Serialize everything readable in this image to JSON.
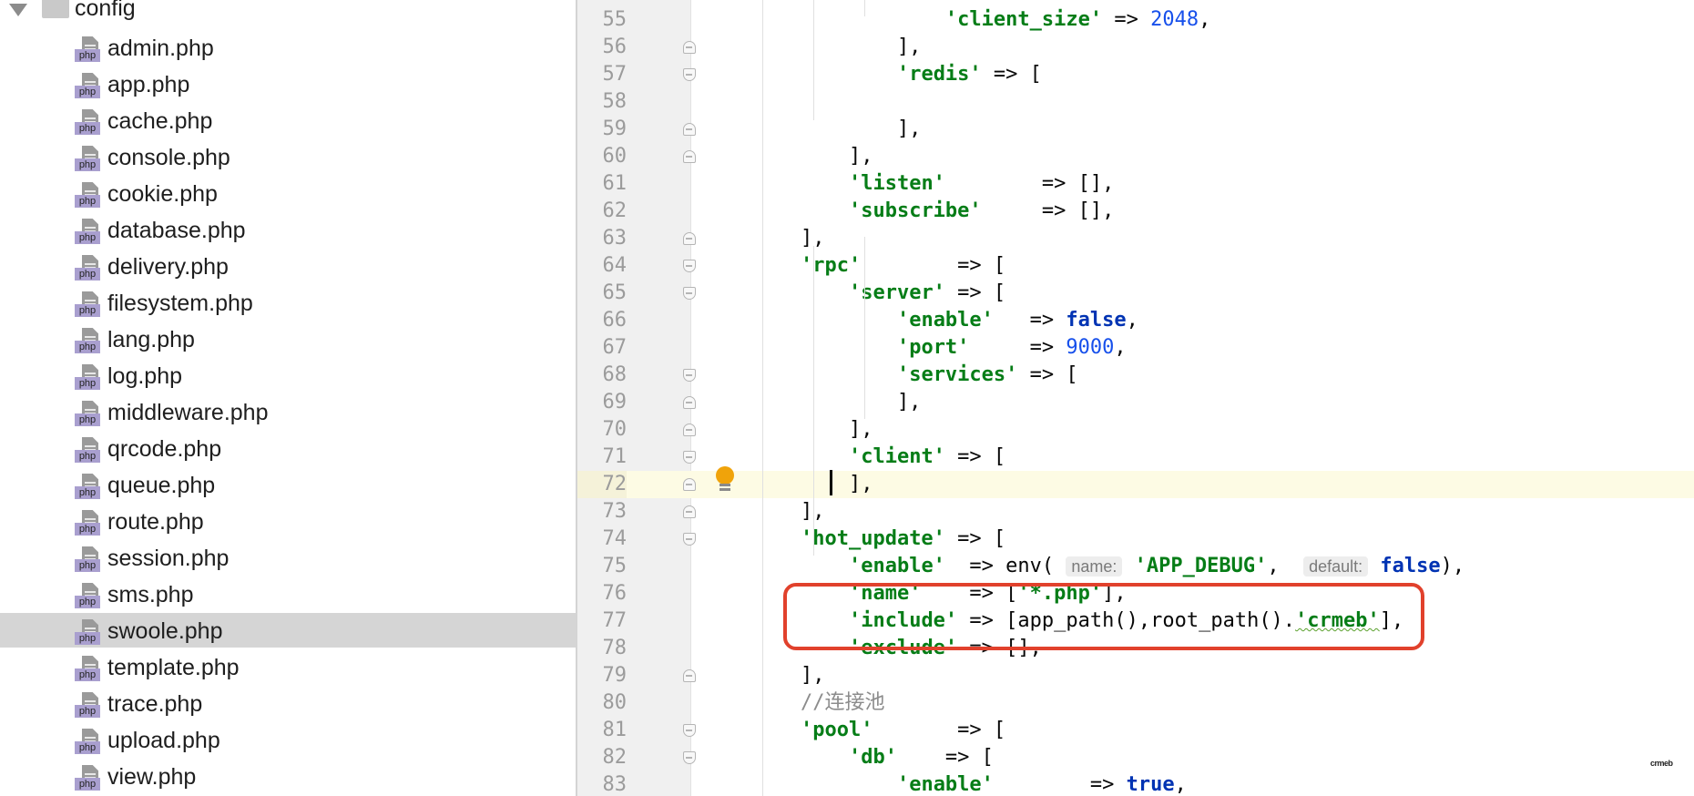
{
  "tree": {
    "folder": "config",
    "files": [
      "admin.php",
      "app.php",
      "cache.php",
      "console.php",
      "cookie.php",
      "database.php",
      "delivery.php",
      "filesystem.php",
      "lang.php",
      "log.php",
      "middleware.php",
      "qrcode.php",
      "queue.php",
      "route.php",
      "session.php",
      "sms.php",
      "swoole.php",
      "template.php",
      "trace.php",
      "upload.php",
      "view.php"
    ],
    "selected": "swoole.php",
    "file_tag": "php"
  },
  "editor": {
    "current_line": "72",
    "lines": [
      {
        "n": "55",
        "fold": "",
        "code": "                <s>'client_size'</s> => <n>2048</n>,"
      },
      {
        "n": "56",
        "fold": "close",
        "code": "            ],"
      },
      {
        "n": "57",
        "fold": "open",
        "code": "            <s>'redis'</s> => ["
      },
      {
        "n": "58",
        "fold": "",
        "code": ""
      },
      {
        "n": "59",
        "fold": "close",
        "code": "            ],"
      },
      {
        "n": "60",
        "fold": "close",
        "code": "        ],"
      },
      {
        "n": "61",
        "fold": "",
        "code": "        <s>'listen'</s>        => [],"
      },
      {
        "n": "62",
        "fold": "",
        "code": "        <s>'subscribe'</s>     => [],"
      },
      {
        "n": "63",
        "fold": "close",
        "code": "    ],"
      },
      {
        "n": "64",
        "fold": "open",
        "code": "    <s>'rpc'</s>        => ["
      },
      {
        "n": "65",
        "fold": "open",
        "code": "        <s>'server'</s> => ["
      },
      {
        "n": "66",
        "fold": "",
        "code": "            <s>'enable'</s>   => <k>false</k>,"
      },
      {
        "n": "67",
        "fold": "",
        "code": "            <s>'port'</s>     => <n>9000</n>,"
      },
      {
        "n": "68",
        "fold": "open",
        "code": "            <s>'services'</s> => ["
      },
      {
        "n": "69",
        "fold": "close",
        "code": "            ],"
      },
      {
        "n": "70",
        "fold": "close",
        "code": "        ],"
      },
      {
        "n": "71",
        "fold": "open",
        "code": "        <s>'client'</s> => ["
      },
      {
        "n": "72",
        "fold": "close",
        "code": "        ],"
      },
      {
        "n": "73",
        "fold": "close",
        "code": "    ],"
      },
      {
        "n": "74",
        "fold": "open",
        "code": "    <s>'hot_update'</s> => ["
      },
      {
        "n": "75",
        "fold": "",
        "code": "        <s>'enable'</s>  => env( <h>name:</h> <s>'APP_DEBUG'</s>,  <h>default:</h> <k>false</k>),"
      },
      {
        "n": "76",
        "fold": "",
        "code": "        <s>'name'</s>    => [<s>'*.php'</s>],"
      },
      {
        "n": "77",
        "fold": "",
        "code": "        <s>'include'</s> => [app_path(),root_path().<w>'crmeb'</w>],"
      },
      {
        "n": "78",
        "fold": "",
        "code": "        <s>'exclude'</s> => [],"
      },
      {
        "n": "79",
        "fold": "close",
        "code": "    ],"
      },
      {
        "n": "80",
        "fold": "",
        "code": "    <c>//连接池</c>"
      },
      {
        "n": "81",
        "fold": "open",
        "code": "    <s>'pool'</s>       => ["
      },
      {
        "n": "82",
        "fold": "open",
        "code": "        <s>'db'</s>    => ["
      },
      {
        "n": "83",
        "fold": "",
        "code": "            <s>'enable'</s>        => <k>true</k>,"
      }
    ]
  },
  "watermark": "crmeb",
  "colors": {
    "string": "#067d17",
    "number": "#1750eb",
    "keyword": "#0033b3",
    "comment": "#8c8c8c",
    "highlight_box": "#e1412c",
    "selected_row": "#d5d5d5",
    "current_line": "#fdfbe4"
  }
}
